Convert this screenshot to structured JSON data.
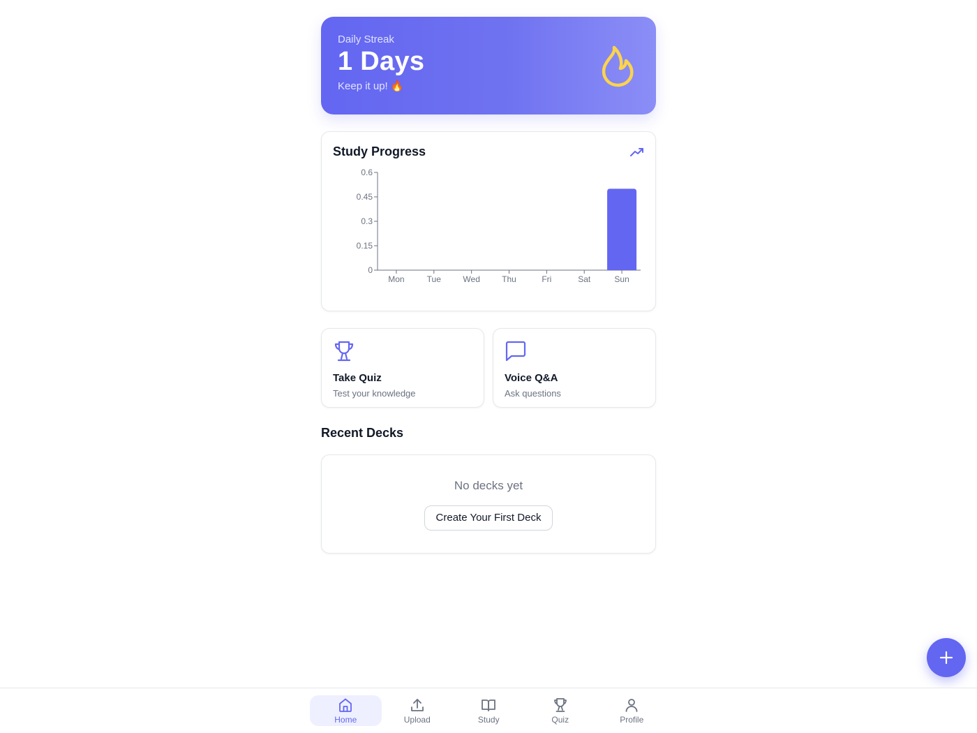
{
  "streak": {
    "label": "Daily Streak",
    "value": "1 Days",
    "subtitle": "Keep it up! 🔥",
    "icon": "flame-icon"
  },
  "progress": {
    "title": "Study Progress",
    "icon": "trending-up-icon"
  },
  "chart_data": {
    "type": "bar",
    "categories": [
      "Mon",
      "Tue",
      "Wed",
      "Thu",
      "Fri",
      "Sat",
      "Sun"
    ],
    "values": [
      0,
      0,
      0,
      0,
      0,
      0,
      0.5
    ],
    "yticks": [
      "0",
      "0.15",
      "0.3",
      "0.45",
      "0.6"
    ],
    "ytick_values": [
      0,
      0.15,
      0.3,
      0.45,
      0.6
    ],
    "ylim": [
      0,
      0.6
    ],
    "grid": false,
    "bar_color": "#6366f1"
  },
  "actions": [
    {
      "title": "Take Quiz",
      "subtitle": "Test your knowledge",
      "icon": "trophy-icon"
    },
    {
      "title": "Voice Q&A",
      "subtitle": "Ask questions",
      "icon": "message-square-icon"
    }
  ],
  "recent": {
    "title": "Recent Decks",
    "empty_text": "No decks yet",
    "create_label": "Create Your First Deck"
  },
  "fab": {
    "icon": "plus-icon"
  },
  "nav": [
    {
      "label": "Home",
      "icon": "home-icon",
      "active": true
    },
    {
      "label": "Upload",
      "icon": "upload-icon",
      "active": false
    },
    {
      "label": "Study",
      "icon": "book-open-icon",
      "active": false
    },
    {
      "label": "Quiz",
      "icon": "trophy-icon",
      "active": false
    },
    {
      "label": "Profile",
      "icon": "user-icon",
      "active": false
    }
  ],
  "colors": {
    "accent": "#6366f1",
    "flame": "#fcd34d",
    "muted": "#6b7280"
  }
}
